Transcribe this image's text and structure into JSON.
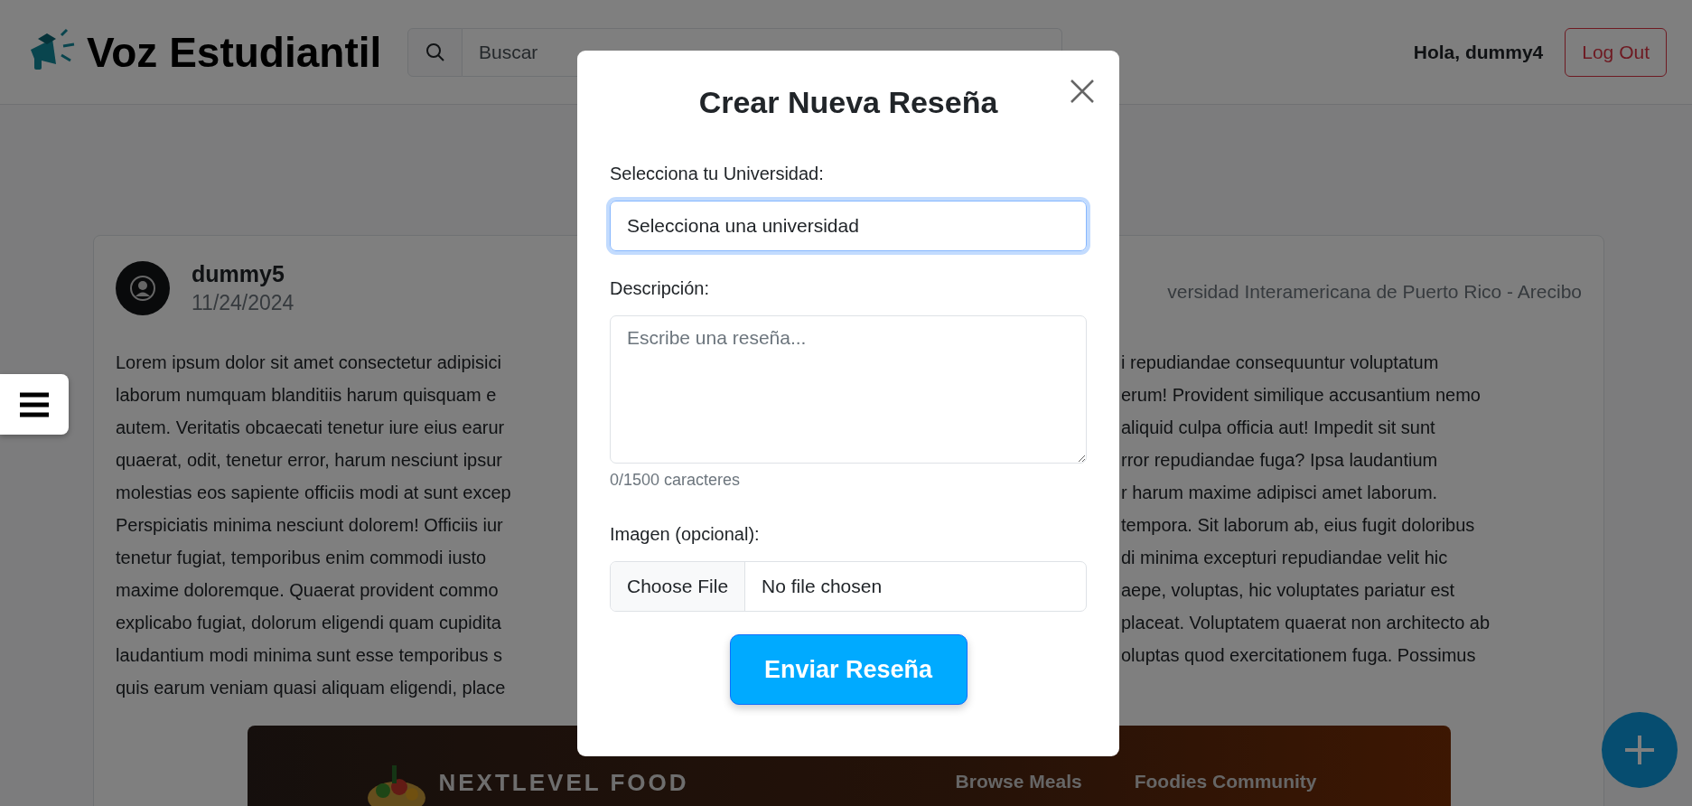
{
  "header": {
    "brand": "Voz Estudiantil",
    "search": {
      "placeholder": "Buscar"
    },
    "greeting": "Hola, dummy4",
    "logout": "Log Out"
  },
  "post": {
    "author": "dummy5",
    "date": "11/24/2024",
    "university": "versidad Interamericana de Puerto Rico - Arecibo",
    "lines": [
      {
        "left": "Lorem ipsum dolor sit amet consectetur adipisici",
        "right": "i repudiandae consequuntur voluptatum"
      },
      {
        "left": "laborum numquam blanditiis harum quisquam e",
        "right": "erum! Provident similique accusantium nemo"
      },
      {
        "left": "autem. Veritatis obcaecati tenetur iure eius earur",
        "right": "aliquid culpa officia aut! Impedit sit sunt"
      },
      {
        "left": "quaerat, odit, tenetur error, harum nesciunt ipsur",
        "right": "rror repudiandae fuga? Ipsa laudantium"
      },
      {
        "left": "molestias eos sapiente officiis modi at sunt excep",
        "right": "r harum maxime adipisci amet laborum."
      },
      {
        "left": "Perspiciatis minima nesciunt dolorem! Officiis iur",
        "right": "tempora. Sit laborum ab, eius fugit doloribus"
      },
      {
        "left": "tenetur fugiat, temporibus enim commodi iusto",
        "right": "di minima excepturi repudiandae velit hic"
      },
      {
        "left": "maxime doloremque. Quaerat provident commo",
        "right": "aepe, voluptas, hic voluptates pariatur est"
      },
      {
        "left": "explicabo fugiat, dolorum eligendi quam cupidita",
        "right": "placeat. Voluptatem quaerat non architecto ab"
      },
      {
        "left": "laudantium modi minima sunt esse temporibus s",
        "right": "oluptas quod exercitationem fuga. Possimus"
      },
      {
        "left": "quis earum veniam quasi aliquam eligendi, place"
      }
    ],
    "image": {
      "kind": "screenshot",
      "brand": "NEXTLEVEL FOOD",
      "links": [
        "Browse Meals",
        "Foodies Community"
      ]
    }
  },
  "modal": {
    "title": "Crear Nueva Reseña",
    "university_label": "Selecciona tu Universidad:",
    "university_value": "Selecciona una universidad",
    "university_focused": true,
    "description_label": "Descripción:",
    "description_placeholder": "Escribe una reseña...",
    "counter": "0/1500 caracteres",
    "image_label": "Imagen (opcional):",
    "file_button": "Choose File",
    "file_status": "No file chosen",
    "submit": "Enviar Reseña"
  }
}
